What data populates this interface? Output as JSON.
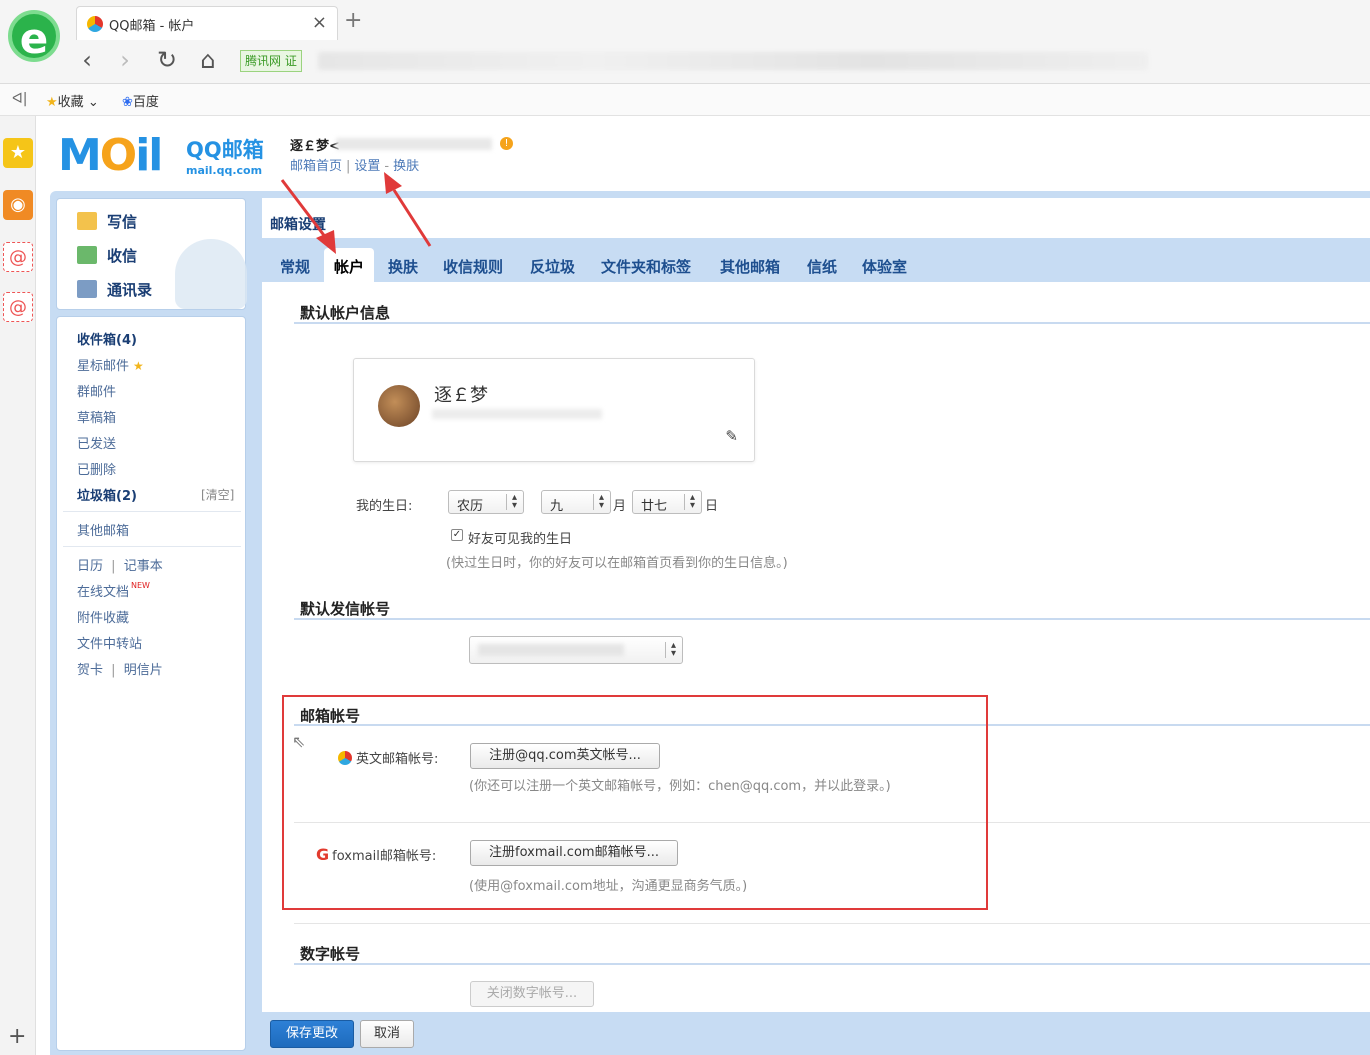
{
  "browser": {
    "tab_title": "QQ邮箱 - 帐户",
    "tab_close": "×",
    "new_tab": "+",
    "back": "‹",
    "forward": "›",
    "reload": "↻",
    "home": "⌂",
    "address_badge": "腾讯网 证",
    "bookmarks": {
      "collapse": "ᐊ|",
      "favorites": "收藏",
      "favorites_arrow": "⌄",
      "baidu": "百度"
    },
    "sidebar_add": "+"
  },
  "header": {
    "logo_text": "QQ邮箱",
    "logo_url": "mail.qq.com",
    "user_name": "逐￡梦<",
    "links": [
      "邮箱首页",
      "设置",
      "换肤"
    ],
    "link_separators": [
      "|",
      "-"
    ]
  },
  "quick_actions": [
    "写信",
    "收信",
    "通讯录"
  ],
  "folders": {
    "inbox": "收件箱(4)",
    "starred": "星标邮件",
    "group": "群邮件",
    "drafts": "草稿箱",
    "sent": "已发送",
    "deleted": "已删除",
    "spam": "垃圾箱(2)",
    "spam_clear": "[清空]",
    "other_mailboxes": "其他邮箱",
    "calendar": "日历",
    "notes": "记事本",
    "online_docs": "在线文档",
    "new_badge": "NEW",
    "attachments": "附件收藏",
    "file_transfer": "文件中转站",
    "cards": "贺卡",
    "postcards": "明信片",
    "sep": "|"
  },
  "main": {
    "title": "邮箱设置",
    "tabs": [
      "常规",
      "帐户",
      "换肤",
      "收信规则",
      "反垃圾",
      "文件夹和标签",
      "其他邮箱",
      "信纸",
      "体验室"
    ],
    "active_tab": "帐户",
    "sections": {
      "default_account": "默认帐户信息",
      "default_sender": "默认发信帐号",
      "mail_accounts": "邮箱帐号",
      "digital_account": "数字帐号"
    },
    "profile": {
      "name": "逐￡梦"
    },
    "birthday": {
      "label": "我的生日:",
      "calendar_type": "农历",
      "month": "九",
      "month_unit": "月",
      "day": "廿七",
      "day_unit": "日",
      "friends_visible": "好友可见我的生日",
      "hint": "(快过生日时，你的好友可以在邮箱首页看到你的生日信息。)"
    },
    "english_account": {
      "label": "英文邮箱帐号:",
      "button": "注册@qq.com英文帐号...",
      "hint": "(你还可以注册一个英文邮箱帐号，例如：chen@qq.com，并以此登录。)"
    },
    "foxmail_account": {
      "label": "foxmail邮箱帐号:",
      "button": "注册foxmail.com邮箱帐号...",
      "hint": "(使用@foxmail.com地址，沟通更显商务气质。)"
    },
    "digital_button": "关闭数字帐号...",
    "save": "保存更改",
    "cancel": "取消"
  },
  "colors": {
    "brand_blue": "#2592e3",
    "frame_blue": "#c7dcf3",
    "annotation_red": "#e03a3a"
  }
}
